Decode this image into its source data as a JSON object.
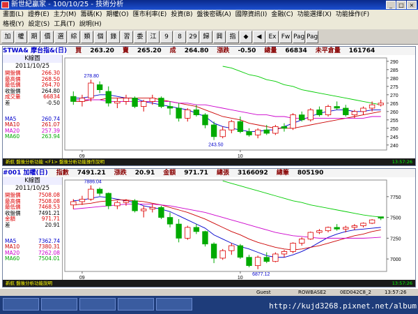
{
  "window": {
    "title": "新世紀贏家 - 100/10/25 - 技術分析"
  },
  "menu": {
    "row1": [
      "畫面(L)",
      "證券(E)",
      "主力(M)",
      "籌碼(K)",
      "期權(O)",
      "匯市利率(E)",
      "投資(B)",
      "盤後密碼(A)",
      "國際資訊(I)",
      "金融(C)",
      "功能選擇(X)",
      "功能操作(F)"
    ],
    "row2": [
      "格視(Y)",
      "設定(S)",
      "工具(T)",
      "說明(H)"
    ]
  },
  "toolbar": [
    "加",
    "權",
    "期",
    "價",
    "選",
    "綜",
    "類",
    "個",
    "錄",
    "習",
    "委",
    "江",
    "9",
    "8",
    "29",
    "歸",
    "興",
    "指",
    "◆",
    "◀",
    "Ex",
    "Fw",
    "Page",
    "Page"
  ],
  "panel1": {
    "header": [
      "STWA& 摩台指&(日)",
      "買",
      "263.20",
      "賣",
      "265.20",
      "成",
      "264.80",
      "漲跌",
      "-0.50",
      "總量",
      "66834",
      "未平倉量",
      "161764"
    ],
    "info_title": "K線圖",
    "date": "2011/10/25",
    "rows": [
      {
        "k": "開盤價",
        "v": "266.30",
        "c": "#d00"
      },
      {
        "k": "最高價",
        "v": "268.50",
        "c": "#d00"
      },
      {
        "k": "最低價",
        "v": "264.70",
        "c": "#d00"
      },
      {
        "k": "收盤價",
        "v": "264.80",
        "c": "#000"
      },
      {
        "k": "成交量",
        "v": "66834",
        "c": "#d00"
      },
      {
        "k": "差",
        "v": "-0.50",
        "c": "#000"
      }
    ],
    "ma": [
      {
        "k": "MA5",
        "v": "260.74",
        "c": "#00c"
      },
      {
        "k": "MA10",
        "v": "261.07",
        "c": "#c00"
      },
      {
        "k": "MA20",
        "v": "257.39",
        "c": "#c0c"
      },
      {
        "k": "MA60",
        "v": "263.94",
        "c": "#0a0"
      }
    ],
    "footer": "新航  盤後分析功能  <F1> 盤後分析功能操作說明",
    "footer_time": "13:57:26"
  },
  "panel2": {
    "header": [
      "#001 加權(日)",
      "指數",
      "7491.21",
      "漲跌",
      "20.91",
      "金額",
      "971.71",
      "總張",
      "3166092",
      "總筆",
      "805190"
    ],
    "info_title": "K線圖",
    "date": "2011/10/25",
    "rows": [
      {
        "k": "開盤價",
        "v": "7508.08",
        "c": "#d00"
      },
      {
        "k": "最高價",
        "v": "7508.08",
        "c": "#d00"
      },
      {
        "k": "最低價",
        "v": "7468.53",
        "c": "#d00"
      },
      {
        "k": "收盤價",
        "v": "7491.21",
        "c": "#000"
      },
      {
        "k": "金額",
        "v": "971.71",
        "c": "#d00"
      },
      {
        "k": "差",
        "v": "20.91",
        "c": "#000"
      }
    ],
    "ma": [
      {
        "k": "MA5",
        "v": "7362.74",
        "c": "#00c"
      },
      {
        "k": "MA10",
        "v": "7380.31",
        "c": "#c00"
      },
      {
        "k": "MA20",
        "v": "7262.08",
        "c": "#c0c"
      },
      {
        "k": "MA60",
        "v": "7504.01",
        "c": "#0a0"
      }
    ],
    "footer": "新航  盤後分析功能說明",
    "footer_time": "13:57:26"
  },
  "chart_data": [
    {
      "type": "candlestick",
      "title": "STWA& 摩台指&(日)",
      "ylim": [
        237,
        292
      ],
      "yticks": [
        240,
        245,
        250,
        255,
        260,
        265,
        270,
        275,
        280,
        285,
        290
      ],
      "x_labels": [
        "09",
        "10"
      ],
      "annotations": [
        "278.80",
        "243.50"
      ],
      "ohlc": [
        [
          269,
          272,
          264,
          266
        ],
        [
          266,
          270,
          263,
          268
        ],
        [
          268,
          279,
          266,
          277
        ],
        [
          276,
          278,
          271,
          273
        ],
        [
          272,
          275,
          263,
          265
        ],
        [
          265,
          268,
          262,
          266
        ],
        [
          266,
          270,
          264,
          268
        ],
        [
          268,
          269,
          262,
          263
        ],
        [
          263,
          267,
          260,
          266
        ],
        [
          266,
          270,
          264,
          268
        ],
        [
          268,
          269,
          262,
          263
        ],
        [
          263,
          266,
          258,
          262
        ],
        [
          262,
          265,
          254,
          256
        ],
        [
          256,
          262,
          254,
          261
        ],
        [
          261,
          264,
          257,
          258
        ],
        [
          258,
          259,
          250,
          252
        ],
        [
          252,
          254,
          243,
          245
        ],
        [
          245,
          251,
          244,
          249
        ],
        [
          249,
          255,
          247,
          254
        ],
        [
          254,
          257,
          247,
          248
        ],
        [
          248,
          250,
          245,
          246
        ],
        [
          246,
          250,
          244,
          249
        ],
        [
          249,
          252,
          246,
          247
        ],
        [
          247,
          252,
          246,
          251
        ],
        [
          251,
          253,
          248,
          250
        ],
        [
          250,
          259,
          249,
          258
        ],
        [
          258,
          260,
          254,
          255
        ],
        [
          255,
          262,
          254,
          261
        ],
        [
          261,
          263,
          257,
          258
        ],
        [
          258,
          264,
          257,
          263
        ],
        [
          263,
          266,
          261,
          262
        ],
        [
          262,
          264,
          257,
          258
        ],
        [
          258,
          261,
          256,
          260
        ],
        [
          260,
          263,
          258,
          262
        ],
        [
          262,
          266,
          260,
          264
        ],
        [
          264,
          267,
          263,
          265
        ]
      ],
      "ma": {
        "MA5": [
          268,
          268,
          269,
          270,
          270,
          269,
          268,
          268,
          266,
          265,
          264,
          263,
          262,
          261,
          259,
          257,
          253,
          251,
          250,
          249,
          248,
          248,
          249,
          249,
          251,
          253,
          255,
          257,
          259,
          260,
          261,
          261,
          260,
          260,
          261,
          261
        ],
        "MA10": [
          266,
          266,
          267,
          267,
          268,
          268,
          268,
          268,
          268,
          268,
          267,
          266,
          265,
          264,
          263,
          261,
          259,
          257,
          256,
          255,
          253,
          252,
          251,
          250,
          250,
          250,
          251,
          252,
          253,
          254,
          255,
          256,
          257,
          258,
          259,
          260
        ],
        "MA20": [
          267,
          267,
          267,
          267,
          266,
          266,
          266,
          266,
          266,
          266,
          266,
          266,
          265,
          265,
          264,
          264,
          263,
          262,
          261,
          260,
          259,
          258,
          258,
          257,
          257,
          256,
          256,
          256,
          256,
          256,
          256,
          256,
          256,
          256,
          257,
          257
        ],
        "MA60": [
          null,
          null,
          null,
          null,
          null,
          null,
          null,
          null,
          null,
          null,
          null,
          null,
          null,
          null,
          null,
          null,
          null,
          287,
          286,
          284,
          282,
          281,
          279,
          278,
          276,
          275,
          273,
          272,
          271,
          270,
          269,
          268,
          267,
          266,
          265,
          264
        ]
      },
      "colors": {
        "up": "#d00",
        "down": "#0a0",
        "ma5": "#00c",
        "ma10": "#c00",
        "ma20": "#c0c",
        "ma60": "#0c0"
      }
    },
    {
      "type": "candlestick",
      "title": "#001 加權(日)",
      "ylim": [
        6850,
        7950
      ],
      "yticks": [
        7000,
        7250,
        7500,
        7750
      ],
      "x_labels": [
        "09",
        "10"
      ],
      "annotations": [
        "7886.04",
        "6877.12"
      ],
      "ohlc": [
        [
          7650,
          7720,
          7600,
          7690
        ],
        [
          7690,
          7760,
          7650,
          7720
        ],
        [
          7720,
          7886,
          7700,
          7840
        ],
        [
          7840,
          7860,
          7760,
          7790
        ],
        [
          7790,
          7800,
          7600,
          7640
        ],
        [
          7640,
          7700,
          7600,
          7680
        ],
        [
          7680,
          7720,
          7640,
          7700
        ],
        [
          7700,
          7720,
          7560,
          7580
        ],
        [
          7580,
          7640,
          7500,
          7600
        ],
        [
          7600,
          7660,
          7560,
          7620
        ],
        [
          7620,
          7640,
          7480,
          7500
        ],
        [
          7500,
          7560,
          7380,
          7420
        ],
        [
          7420,
          7480,
          7200,
          7250
        ],
        [
          7250,
          7400,
          7230,
          7380
        ],
        [
          7380,
          7420,
          7300,
          7330
        ],
        [
          7330,
          7340,
          7150,
          7180
        ],
        [
          7180,
          7200,
          6950,
          7010
        ],
        [
          7010,
          7120,
          6990,
          7100
        ],
        [
          7100,
          7190,
          7050,
          7160
        ],
        [
          7160,
          7180,
          7000,
          7020
        ],
        [
          7020,
          7050,
          6900,
          6920
        ],
        [
          6920,
          7040,
          6877,
          7020
        ],
        [
          7020,
          7080,
          6950,
          6970
        ],
        [
          6970,
          7080,
          6960,
          7060
        ],
        [
          7060,
          7110,
          7020,
          7090
        ],
        [
          7090,
          7200,
          7070,
          7190
        ],
        [
          7190,
          7260,
          7160,
          7240
        ],
        [
          7240,
          7330,
          7230,
          7320
        ],
        [
          7320,
          7360,
          7300,
          7340
        ],
        [
          7340,
          7390,
          7320,
          7380
        ],
        [
          7380,
          7420,
          7340,
          7360
        ],
        [
          7360,
          7400,
          7320,
          7380
        ],
        [
          7380,
          7420,
          7350,
          7400
        ],
        [
          7400,
          7440,
          7380,
          7430
        ],
        [
          7430,
          7480,
          7420,
          7470
        ],
        [
          7508,
          7508,
          7468,
          7491
        ]
      ],
      "ma": {
        "MA5": [
          7700,
          7710,
          7730,
          7750,
          7740,
          7720,
          7700,
          7680,
          7640,
          7620,
          7600,
          7570,
          7520,
          7470,
          7420,
          7370,
          7290,
          7240,
          7190,
          7150,
          7120,
          7080,
          7040,
          7020,
          7020,
          7050,
          7090,
          7140,
          7200,
          7260,
          7300,
          7330,
          7350,
          7360,
          7370,
          7380
        ],
        "MA10": [
          7650,
          7660,
          7670,
          7690,
          7700,
          7710,
          7710,
          7700,
          7690,
          7670,
          7650,
          7620,
          7590,
          7560,
          7520,
          7480,
          7430,
          7380,
          7330,
          7290,
          7240,
          7200,
          7170,
          7140,
          7120,
          7110,
          7120,
          7140,
          7160,
          7190,
          7220,
          7250,
          7280,
          7300,
          7330,
          7350
        ],
        "MA20": [
          7600,
          7610,
          7620,
          7630,
          7640,
          7650,
          7660,
          7660,
          7660,
          7660,
          7650,
          7640,
          7620,
          7600,
          7580,
          7560,
          7530,
          7500,
          7470,
          7440,
          7410,
          7380,
          7350,
          7320,
          7300,
          7280,
          7270,
          7260,
          7250,
          7250,
          7250,
          7250,
          7250,
          7250,
          7255,
          7262
        ],
        "MA60": [
          null,
          null,
          null,
          null,
          null,
          null,
          null,
          null,
          null,
          null,
          null,
          null,
          null,
          null,
          null,
          null,
          null,
          7940,
          7910,
          7880,
          7850,
          7820,
          7790,
          7760,
          7730,
          7700,
          7680,
          7650,
          7630,
          7610,
          7590,
          7570,
          7550,
          7530,
          7515,
          7504
        ]
      },
      "colors": {
        "up": "#d00",
        "down": "#0a0",
        "ma5": "#00c",
        "ma10": "#c00",
        "ma20": "#c0c",
        "ma60": "#0c0"
      }
    }
  ],
  "status": {
    "left": "Guest",
    "mid": "ROWBASE2",
    "code": "0ED042C8_2",
    "time": "13:57:26"
  },
  "watermark": "http://kujd3268.pixnet.net/album"
}
